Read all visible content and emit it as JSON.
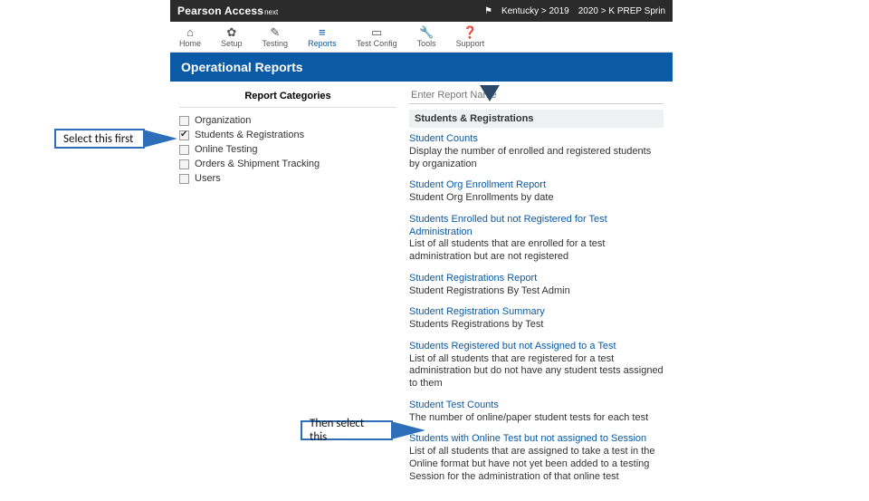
{
  "brand": {
    "main": "Pearson Access",
    "sup": "next"
  },
  "topright": {
    "region": "Kentucky > 2019",
    "program": "2020 > K PREP Sprin"
  },
  "nav": [
    {
      "label": "Home",
      "icon": "⌂"
    },
    {
      "label": "Setup",
      "icon": "✿"
    },
    {
      "label": "Testing",
      "icon": "✎"
    },
    {
      "label": "Reports",
      "icon": "≡",
      "active": true
    },
    {
      "label": "Test Config",
      "icon": "▭"
    },
    {
      "label": "Tools",
      "icon": "🔧"
    },
    {
      "label": "Support",
      "icon": "❓"
    }
  ],
  "banner": "Operational Reports",
  "cat_head": "Report Categories",
  "categories": [
    {
      "label": "Organization",
      "checked": false
    },
    {
      "label": "Students & Registrations",
      "checked": true
    },
    {
      "label": "Online Testing",
      "checked": false
    },
    {
      "label": "Orders & Shipment Tracking",
      "checked": false
    },
    {
      "label": "Users",
      "checked": false
    }
  ],
  "search_placeholder": "Enter Report Name",
  "section_head": "Students & Registrations",
  "reports": [
    {
      "title": "Student Counts",
      "desc": "Display the number of enrolled and registered students by organization"
    },
    {
      "title": "Student Org Enrollment Report",
      "desc": "Student Org Enrollments by date"
    },
    {
      "title": "Students Enrolled but not Registered for Test Administration",
      "desc": "List of all students that are enrolled for a test administration but are not registered"
    },
    {
      "title": "Student Registrations Report",
      "desc": "Student Registrations By Test Admin"
    },
    {
      "title": "Student Registration Summary",
      "desc": "Students Registrations by Test"
    },
    {
      "title": "Students Registered but not Assigned to a Test",
      "desc": "List of all students that are registered for a test administration but do not have any student tests assigned to them"
    },
    {
      "title": "Student Test Counts",
      "desc": "The number of online/paper student tests for each test"
    },
    {
      "title": "Students with Online Test but not assigned to Session",
      "desc": "List of all students that are assigned to take a test in the Online format but have not yet been added to a testing Session for the administration of that online test"
    }
  ],
  "callouts": {
    "first": "Select this first",
    "second": "Then select this"
  }
}
